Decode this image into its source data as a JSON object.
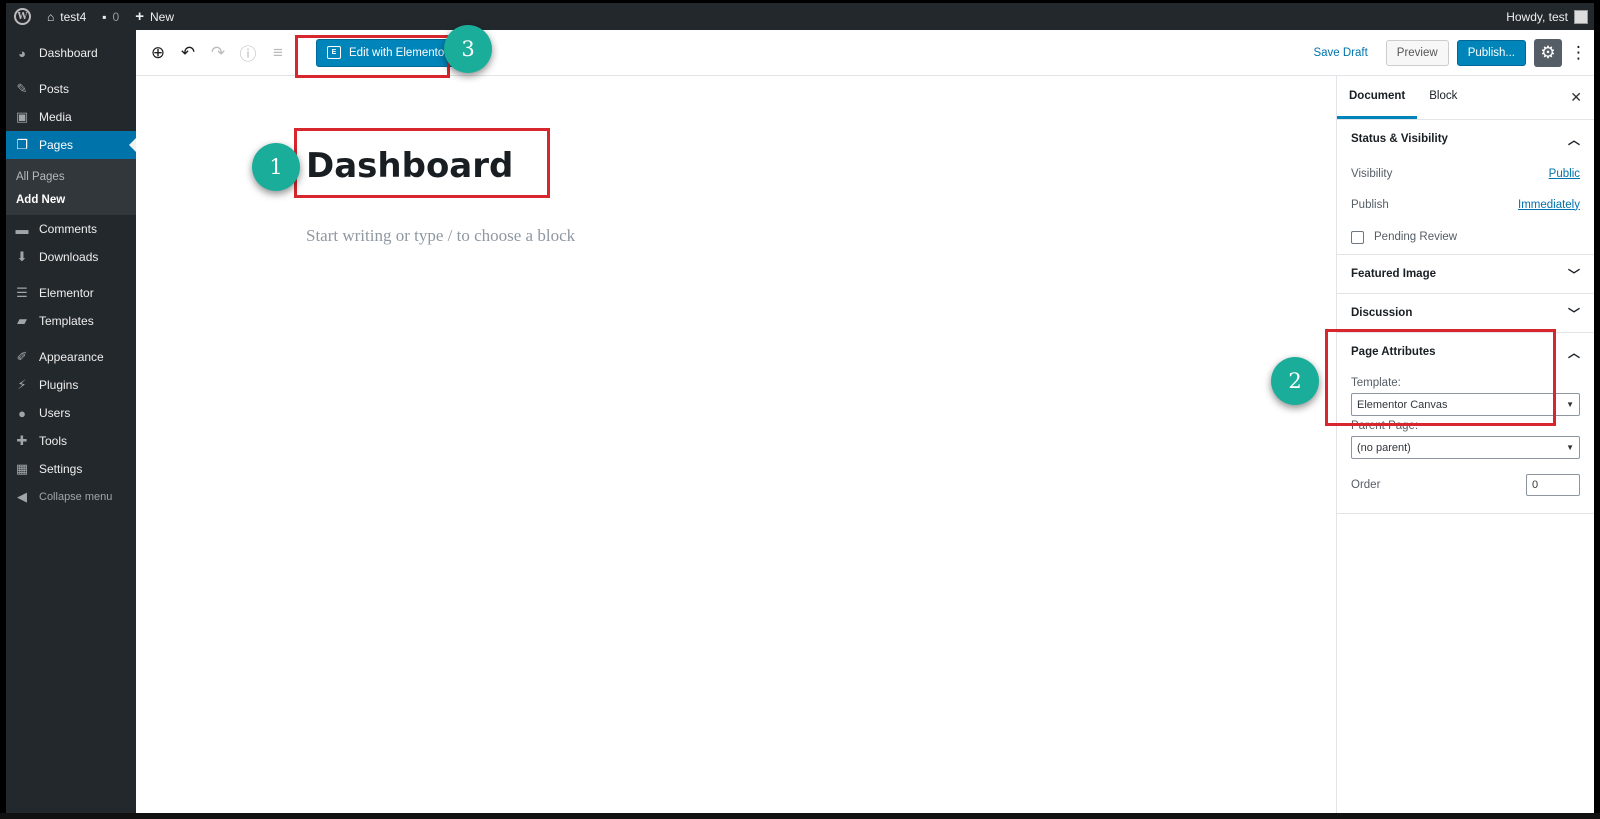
{
  "adminbar": {
    "site_name": "test4",
    "comments_count": "0",
    "new_label": "New",
    "howdy": "Howdy, test"
  },
  "sidebar": {
    "items": [
      {
        "label": "Dashboard",
        "icon": "dashboard-icon"
      },
      {
        "label": "Posts",
        "icon": "pin-icon"
      },
      {
        "label": "Media",
        "icon": "media-icon"
      },
      {
        "label": "Pages",
        "icon": "pages-icon"
      },
      {
        "label": "Comments",
        "icon": "comment-icon"
      },
      {
        "label": "Downloads",
        "icon": "download-icon"
      },
      {
        "label": "Elementor",
        "icon": "elementor-icon"
      },
      {
        "label": "Templates",
        "icon": "folder-icon"
      },
      {
        "label": "Appearance",
        "icon": "brush-icon"
      },
      {
        "label": "Plugins",
        "icon": "plugin-icon"
      },
      {
        "label": "Users",
        "icon": "user-icon"
      },
      {
        "label": "Tools",
        "icon": "wrench-icon"
      },
      {
        "label": "Settings",
        "icon": "settings-icon"
      },
      {
        "label": "Collapse menu",
        "icon": "collapse-icon"
      }
    ],
    "pages_submenu": [
      "All Pages",
      "Add New"
    ]
  },
  "toolbar": {
    "edit_with_elementor": "Edit with Elementor",
    "save_draft": "Save Draft",
    "preview": "Preview",
    "publish": "Publish..."
  },
  "editor": {
    "title": "Dashboard",
    "placeholder": "Start writing or type / to choose a block"
  },
  "panel": {
    "tabs": [
      "Document",
      "Block"
    ],
    "status_visibility": {
      "heading": "Status & Visibility",
      "visibility_label": "Visibility",
      "visibility_value": "Public",
      "publish_label": "Publish",
      "publish_value": "Immediately",
      "pending_review": "Pending Review"
    },
    "featured_image": "Featured Image",
    "discussion": "Discussion",
    "page_attributes": {
      "heading": "Page Attributes",
      "template_label": "Template:",
      "template_value": "Elementor Canvas",
      "parent_label": "Parent Page:",
      "parent_value": "(no parent)",
      "order_label": "Order",
      "order_value": "0"
    }
  },
  "annotations": [
    "1",
    "2",
    "3"
  ],
  "colors": {
    "wp_blue": "#0085ba",
    "admin_dark": "#23282d",
    "annotation_red": "#d7262e",
    "badge_teal": "#1aae9a"
  }
}
